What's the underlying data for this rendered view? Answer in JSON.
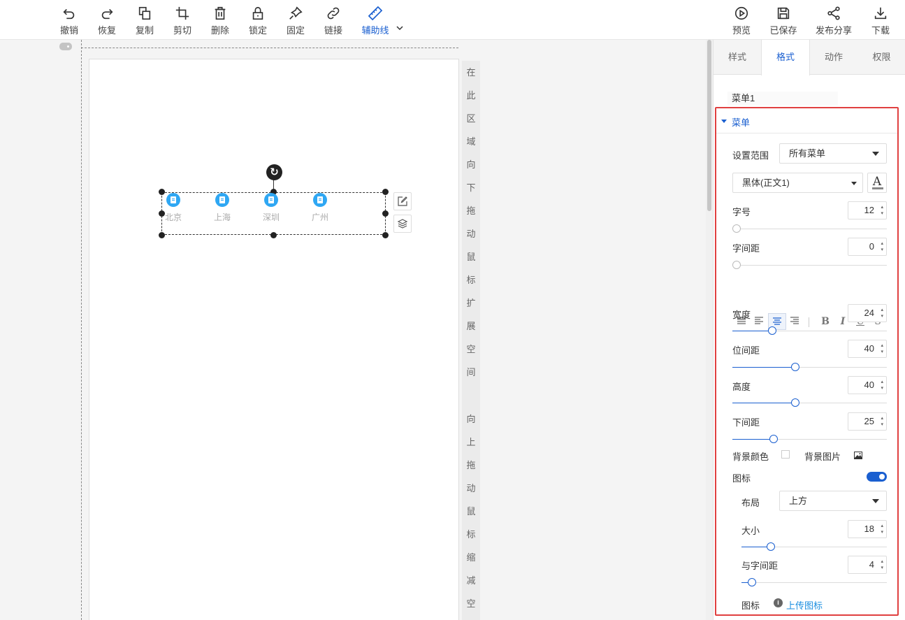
{
  "toolbar": {
    "left": [
      {
        "label": "撤销",
        "icon": "undo-icon"
      },
      {
        "label": "恢复",
        "icon": "redo-icon"
      },
      {
        "label": "复制",
        "icon": "copy-icon"
      },
      {
        "label": "剪切",
        "icon": "crop-icon"
      },
      {
        "label": "删除",
        "icon": "trash-icon"
      },
      {
        "label": "锁定",
        "icon": "lock-icon"
      },
      {
        "label": "固定",
        "icon": "pin-icon"
      },
      {
        "label": "链接",
        "icon": "link-icon"
      },
      {
        "label": "辅助线",
        "icon": "ruler-icon"
      }
    ],
    "right": [
      {
        "label": "预览",
        "icon": "play-icon"
      },
      {
        "label": "已保存",
        "icon": "save-icon"
      },
      {
        "label": "发布分享",
        "icon": "share-icon"
      },
      {
        "label": "下载",
        "icon": "download-icon"
      }
    ]
  },
  "canvas": {
    "hint_top": [
      "在",
      "此",
      "区",
      "域",
      "向",
      "下",
      "拖",
      "动",
      "鼠",
      "标",
      "扩",
      "展",
      "空",
      "间"
    ],
    "hint_bottom": [
      "向",
      "上",
      "拖",
      "动",
      "鼠",
      "标",
      "缩",
      "减",
      "空"
    ],
    "menu_items": [
      "北京",
      "上海",
      "深圳",
      "广州"
    ]
  },
  "panel": {
    "tabs": [
      "样式",
      "格式",
      "动作",
      "权限"
    ],
    "active_tab": "格式",
    "component_name": "菜单1",
    "section_title": "菜单",
    "scope_label": "设置范围",
    "scope_value": "所有菜单",
    "font_value": "黑体(正文1)",
    "font_color_glyph": "A",
    "font_size_label": "字号",
    "font_size": "12",
    "letter_spacing_label": "字间距",
    "letter_spacing": "0",
    "format_buttons": [
      "B",
      "I",
      "U",
      "S"
    ],
    "width_label": "宽度",
    "width": "24",
    "item_spacing_label": "位间距",
    "item_spacing": "40",
    "height_label": "高度",
    "height": "40",
    "bottom_spacing_label": "下间距",
    "bottom_spacing": "25",
    "bg_color_label": "背景颜色",
    "bg_image_label": "背景图片",
    "icon_label": "图标",
    "icon_enabled": true,
    "layout_label": "布局",
    "layout_value": "上方",
    "size_label": "大小",
    "size": "18",
    "text_gap_label": "与字间距",
    "text_gap": "4",
    "icon_row_label": "图标",
    "upload_label": "上传图标"
  }
}
